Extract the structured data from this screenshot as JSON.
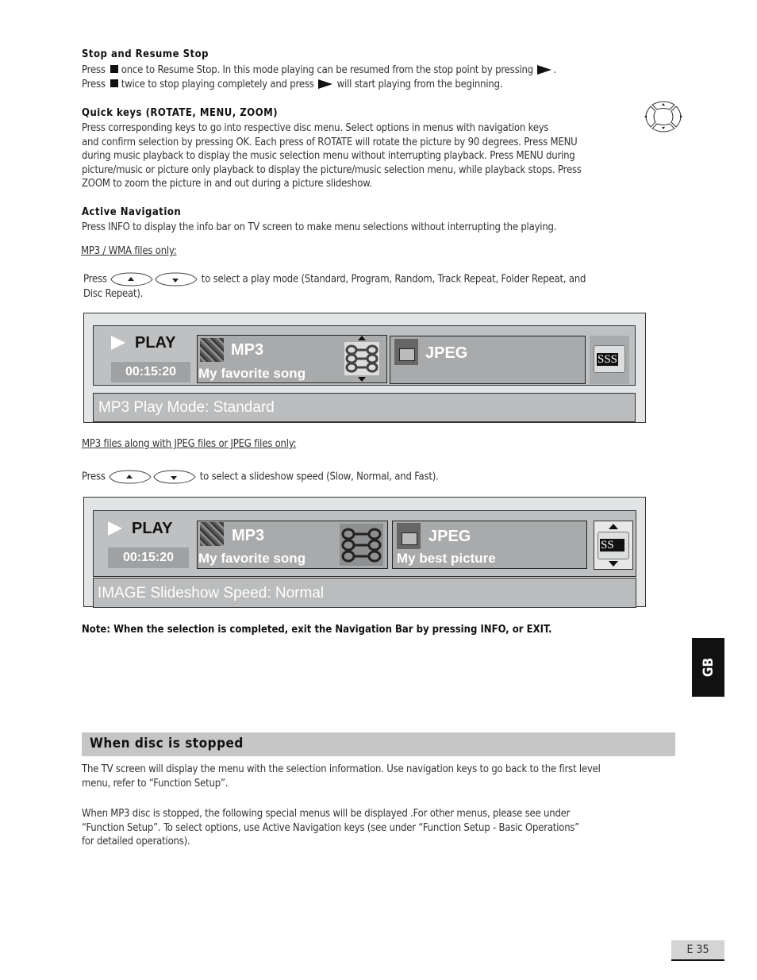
{
  "sections": {
    "stop_resume": {
      "title": "Stop and Resume Stop",
      "line1_a": "Press",
      "line1_b": "once to Resume Stop.  In this mode playing can be resumed from the stop point by pressing",
      "line1_c": ".",
      "line2_a": "Press",
      "line2_b": "twice to stop playing completely and press",
      "line2_c": "will start playing from the beginning."
    },
    "quick_keys": {
      "title": "Quick keys (ROTATE, MENU, ZOOM)",
      "body": [
        "Press corresponding keys to go into respective disc menu.  Select options in menus with navigation keys",
        "and confirm selection by pressing OK.  Each press of ROTATE will rotate the picture by 90 degrees.  Press MENU",
        "during music playback to display the music selection menu without interrupting playback.  Press MENU during",
        "picture/music or picture only playback to display the picture/music selection menu, while playback stops.  Press",
        "ZOOM  to zoom the picture in and out during a picture slideshow."
      ]
    },
    "active_nav": {
      "title": "Active Navigation",
      "body": "Press INFO  to display the info bar on TV screen to make menu selections without interrupting the playing.",
      "mp3_heading": "MP3 / WMA files only:",
      "mp3_press": "Press",
      "mp3_text1": "to select a play mode (Standard, Program, Random, Track Repeat, Folder Repeat, and",
      "mp3_text2": "Disc Repeat).",
      "jpeg_heading": "MP3 files along with JPEG files or JPEG files only:",
      "jpeg_press": "Press",
      "jpeg_text": "to select a slideshow speed (Slow, Normal, and Fast)."
    },
    "note": "Note:  When the selection is completed, exit the Navigation Bar by pressing INFO, or EXIT.",
    "disc_stopped": {
      "title": "When disc is stopped",
      "para1": [
        "The TV screen will display the menu with the selection information.  Use navigation keys to go back to the first level",
        "menu, refer to “Function Setup”."
      ],
      "para2": [
        "When MP3 disc is stopped, the following special menus will be displayed .For other menus, please see under",
        "“Function Setup”. To select options, use Active Navigation keys (see under “Function Setup - Basic Operations”",
        "for detailed operations)."
      ]
    }
  },
  "osd1": {
    "play": "PLAY",
    "time": "00:15:20",
    "mp3_label": "MP3",
    "song": "My favorite song",
    "jpeg_label": "JPEG",
    "jpeg_file": "",
    "speed_badge": "SSS",
    "status": "MP3 Play Mode: Standard"
  },
  "osd2": {
    "play": "PLAY",
    "time": "00:15:20",
    "mp3_label": "MP3",
    "song": "My favorite song",
    "jpeg_label": "JPEG",
    "jpeg_file": "My best picture",
    "speed_badge": "SS",
    "status": "IMAGE Slideshow Speed: Normal"
  },
  "side_tab": "GB",
  "page_number": "E 35"
}
